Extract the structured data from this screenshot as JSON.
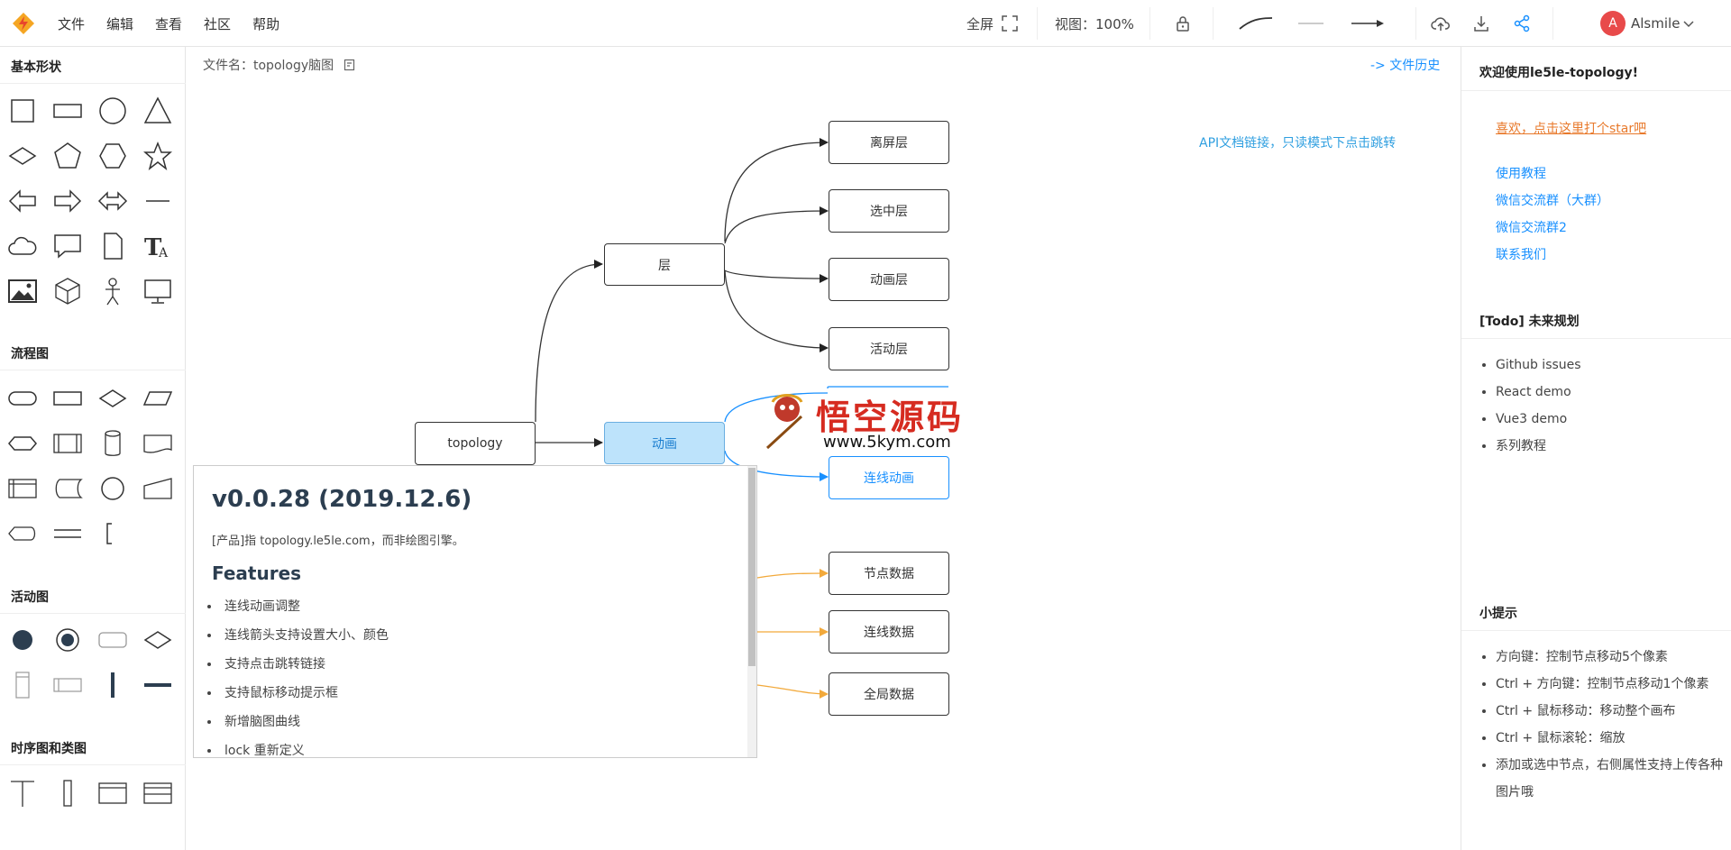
{
  "menu": [
    "文件",
    "编辑",
    "查看",
    "社区",
    "帮助"
  ],
  "toolbar": {
    "fullscreen": "全屏",
    "view_label": "视图：100%",
    "username": "Alsmile",
    "avatar_letter": "A"
  },
  "sidebar": {
    "sections": [
      "基本形状",
      "流程图",
      "活动图",
      "时序图和类图"
    ]
  },
  "canvas": {
    "filename_label": "文件名：topology脑图",
    "history": "-> 文件历史",
    "api_link": "API文档链接，只读模式下点击跳转",
    "nodes": {
      "topology": "topology",
      "layer": "层",
      "animation": "动画",
      "lisping": "离屏层",
      "selected": "选中层",
      "anim_layer": "动画层",
      "active": "活动层",
      "line_anim": "连线动画",
      "node_data": "节点数据",
      "line_data": "连线数据",
      "global_data": "全局数据"
    }
  },
  "changelog": {
    "version": "v0.0.28 (2019.12.6)",
    "intro": "[产品]指 topology.le5le.com，而非绘图引擎。",
    "features_title": "Features",
    "items": [
      "连线动画调整",
      "连线箭头支持设置大小、颜色",
      "支持点击跳转链接",
      "支持鼠标移动提示框",
      "新增脑图曲线",
      "lock 重新定义"
    ]
  },
  "watermark": {
    "title": "悟空源码",
    "url": "www.5kym.com"
  },
  "right": {
    "welcome": "欢迎使用le5le-topology!",
    "star": "喜欢，点击这里打个star吧",
    "links": [
      "使用教程",
      "微信交流群（大群）",
      "微信交流群2",
      "联系我们"
    ],
    "todo_title": "[Todo] 未来规划",
    "todo": [
      "Github issues",
      "React demo",
      "Vue3 demo",
      "系列教程"
    ],
    "tips_title": "小提示",
    "tips": [
      "方向键：控制节点移动5个像素",
      "Ctrl + 方向键：控制节点移动1个像素",
      "Ctrl + 鼠标移动：移动整个画布",
      "Ctrl + 鼠标滚轮：缩放",
      "添加或选中节点，右侧属性支持上传各种图片哦"
    ]
  },
  "colors": {
    "accent": "#1890ff",
    "selected_fill": "#bde3fb",
    "link_orange": "#e8792b",
    "curve_orange": "#f2a93b"
  }
}
